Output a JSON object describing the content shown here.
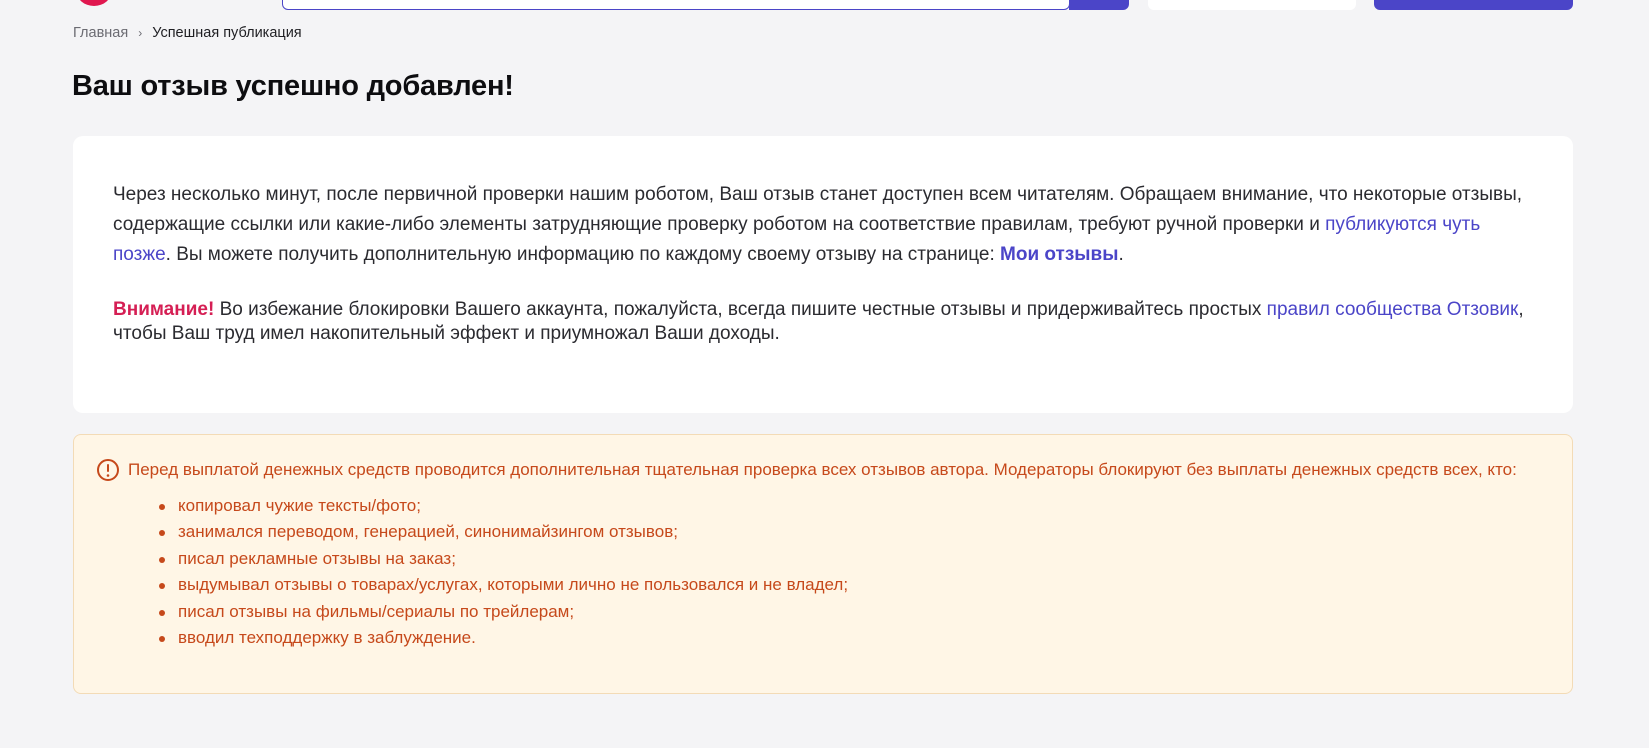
{
  "colors": {
    "accent": "#4b45c8",
    "brand": "#e0174f",
    "attention": "#d51f54",
    "notice_text": "#c6491b",
    "notice_bg": "#fff6e6",
    "page_bg": "#f4f4f6"
  },
  "header": {
    "logo_icon": "logo-icon",
    "search_icon": "search-icon"
  },
  "breadcrumb": {
    "home": "Главная",
    "separator": "›",
    "current": "Успешная публикация"
  },
  "page": {
    "title": "Ваш отзыв успешно добавлен!"
  },
  "card": {
    "info_part1": "Через несколько минут, после первичной проверки нашим роботом, Ваш отзыв станет доступен всем читателям. Обращаем внимание, что некоторые отзывы, содержащие ссылки или какие-либо элементы затрудняющие проверку роботом на соответствие правилам, требуют ручной проверки и ",
    "info_link_later": "публикуются чуть позже",
    "info_part2": ". Вы можете получить дополнительную информацию по каждому своему отзыву на странице: ",
    "info_link_my_reviews": "Мои отзывы",
    "info_part3": ".",
    "attention_label": "Внимание!",
    "warning_part1": " Во избежание блокировки Вашего аккаунта, пожалуйста, всегда пишите честные отзывы и придерживайтесь простых ",
    "warning_link_rules": "правил сообщества Отзовик",
    "warning_part2": ", чтобы Ваш труд имел накопительный эффект и приумножал Ваши доходы."
  },
  "notice": {
    "icon": "exclamation-circle-icon",
    "text": "Перед выплатой денежных средств проводится дополнительная тщательная проверка всех отзывов автора. Модераторы блокируют без выплаты денежных средств всех, кто:",
    "items": [
      "копировал чужие тексты/фото;",
      "занимался переводом, генерацией, синонимайзингом отзывов;",
      "писал рекламные отзывы на заказ;",
      "выдумывал отзывы о товарах/услугах, которыми лично не пользовался и не владел;",
      "писал отзывы на фильмы/сериалы по трейлерам;",
      "вводил техподдержку в заблуждение."
    ]
  }
}
